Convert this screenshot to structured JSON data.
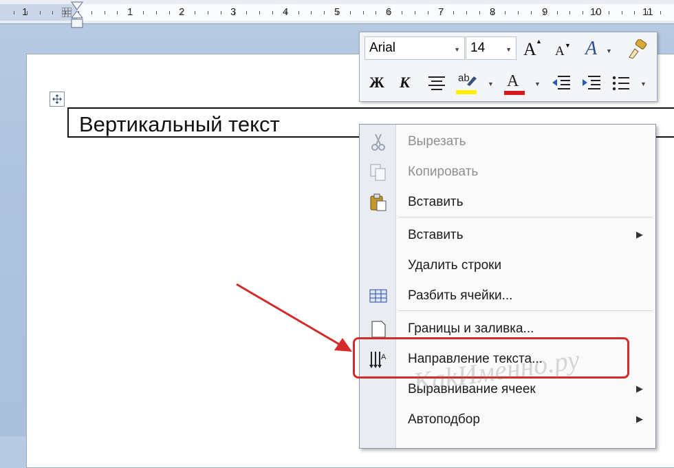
{
  "ruler": {
    "numbers": [
      "1",
      "1",
      "2",
      "3",
      "4",
      "5",
      "6",
      "7",
      "8",
      "9",
      "10",
      "11"
    ]
  },
  "document": {
    "cell_text": "Вертикальный текст"
  },
  "mini_toolbar": {
    "font_name": "Arial",
    "font_size": "14",
    "grow_font": "A",
    "shrink_font": "A",
    "styles": "A",
    "bold": "Ж",
    "italic": "К",
    "highlight_text": "ab",
    "font_color_text": "A",
    "colors": {
      "highlight": "#ffef00",
      "font_color": "#d21b1b"
    }
  },
  "context_menu": {
    "items": [
      {
        "label": "Вырезать",
        "icon": "scissors-icon",
        "disabled": true
      },
      {
        "label": "Копировать",
        "icon": "copy-icon",
        "disabled": true
      },
      {
        "label": "Вставить",
        "icon": "paste-icon",
        "disabled": false
      },
      {
        "label": "Вставить",
        "icon": "",
        "submenu": true
      },
      {
        "label": "Удалить строки",
        "icon": ""
      },
      {
        "label": "Разбить ячейки...",
        "icon": "split-cells-icon"
      },
      {
        "label": "Границы и заливка...",
        "icon": "borders-icon"
      },
      {
        "label": "Направление текста...",
        "icon": "text-direction-icon"
      },
      {
        "label": "Выравнивание ячеек",
        "icon": "",
        "submenu": true
      },
      {
        "label": "Автоподбор",
        "icon": "",
        "submenu": true
      }
    ]
  },
  "annotation": {
    "arrow_color": "#d42a2a",
    "watermark": "KakИменно.ру"
  }
}
